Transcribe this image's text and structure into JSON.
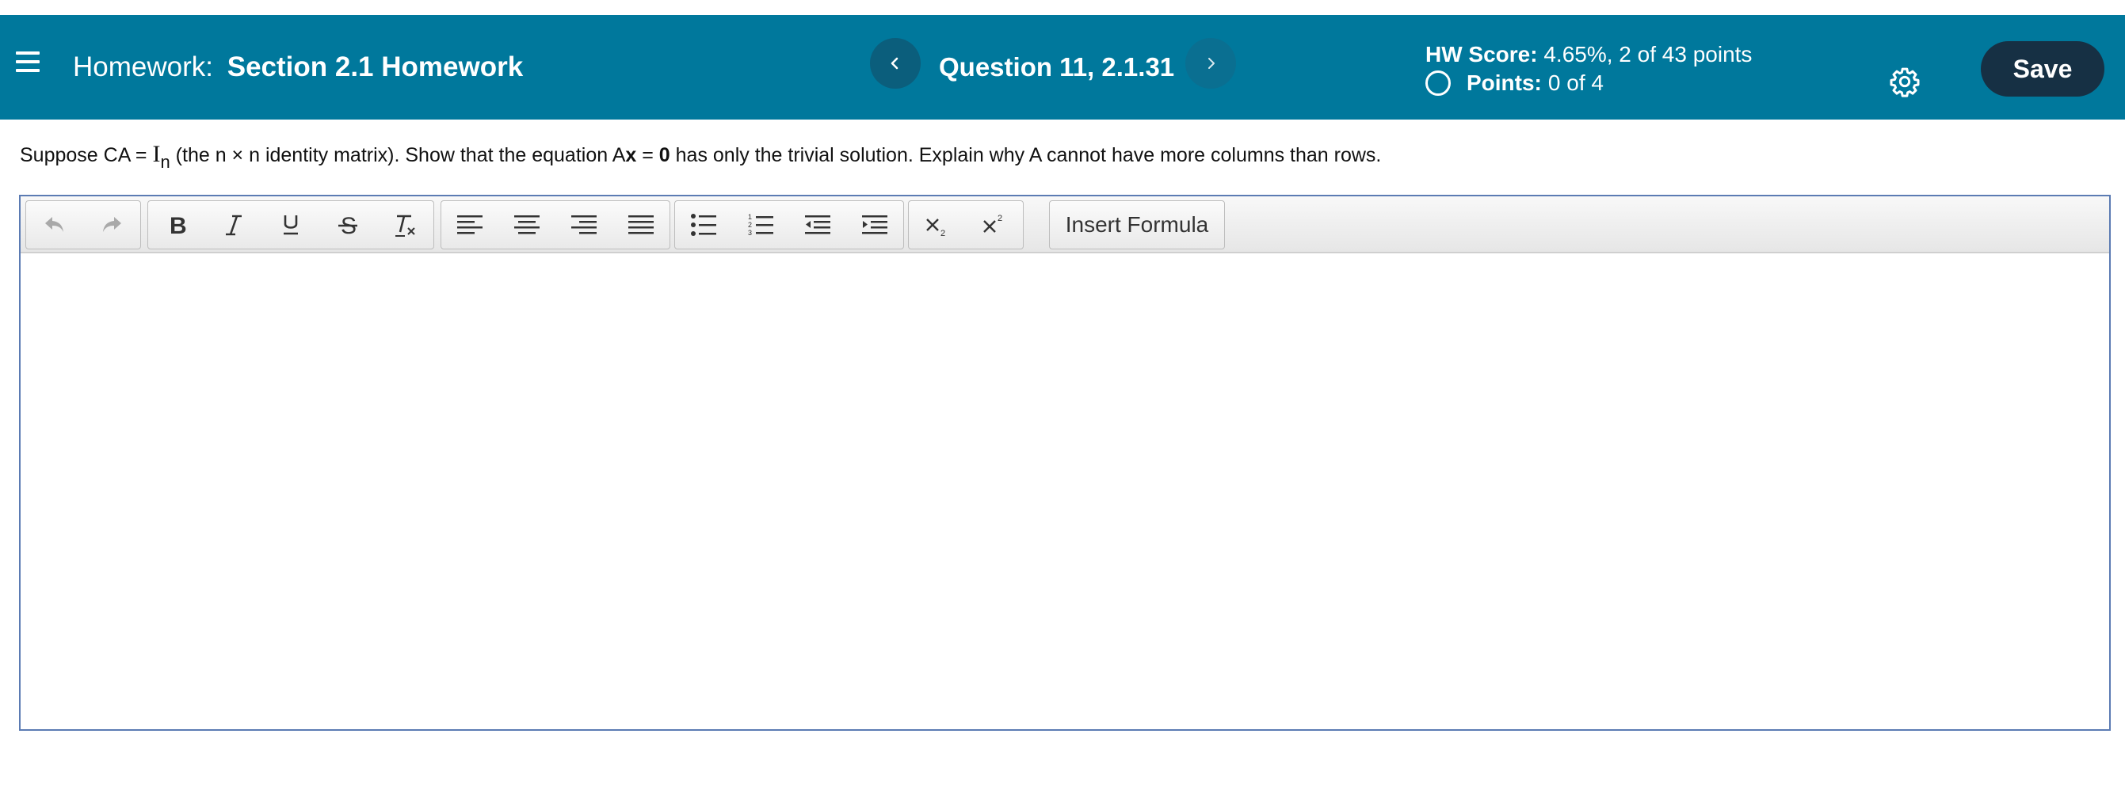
{
  "header": {
    "homework_prefix": "Homework:",
    "homework_name": "Section 2.1 Homework",
    "question_title": "Question 11, 2.1.31",
    "hw_score_label": "HW Score:",
    "hw_score_value": "4.65%, 2 of 43 points",
    "points_label": "Points:",
    "points_value": "0 of 4",
    "save_label": "Save",
    "icons": [
      "hamburger-menu-icon",
      "chevron-left-icon",
      "chevron-right-icon",
      "circle-icon",
      "gear-icon"
    ]
  },
  "question": {
    "part1": "Suppose CA = ",
    "identity_symbol": "I",
    "identity_subscript": "n",
    "part2": " (the n × n identity matrix). Show that the equation A",
    "bold_x": "x",
    "part3": " = ",
    "bold_zero": "0",
    "part4": " has only the trivial solution. Explain why A cannot have more columns than rows."
  },
  "editor": {
    "toolbar_icons": [
      "undo-icon",
      "redo-icon",
      "bold-icon",
      "italic-icon",
      "underline-icon",
      "strikethrough-icon",
      "clear-formatting-icon",
      "align-left-icon",
      "align-center-icon",
      "align-right-icon",
      "align-justify-icon",
      "bulleted-list-icon",
      "numbered-list-icon",
      "outdent-icon",
      "indent-icon",
      "subscript-icon",
      "superscript-icon"
    ],
    "insert_formula_label": "Insert Formula",
    "content": ""
  },
  "colors": {
    "header_bg": "#00789c",
    "save_button_bg": "#163044",
    "editor_border": "#5b7bb3"
  }
}
